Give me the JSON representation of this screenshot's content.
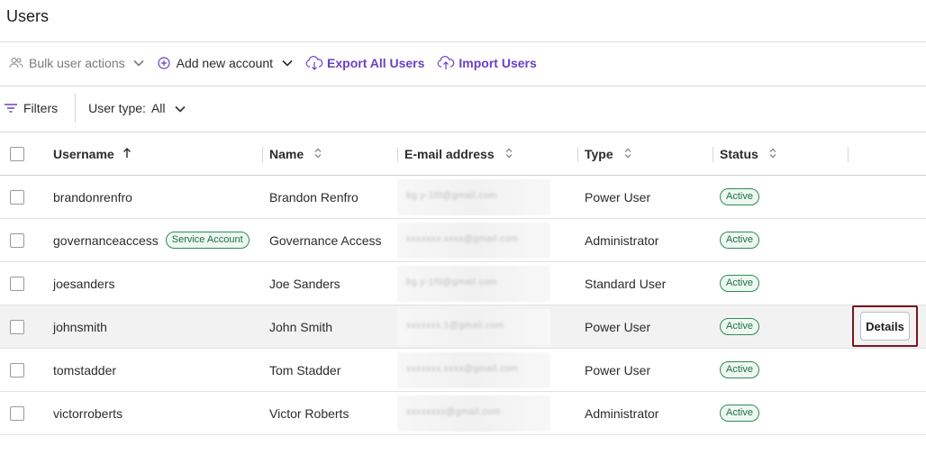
{
  "page": {
    "title": "Users"
  },
  "toolbar": {
    "bulk_label": "Bulk user actions",
    "add_label": "Add new account",
    "export_label": "Export All Users",
    "import_label": "Import Users"
  },
  "filters": {
    "filters_label": "Filters",
    "user_type_label": "User type:",
    "user_type_value": "All"
  },
  "table": {
    "headers": {
      "username": "Username",
      "name": "Name",
      "email": "E-mail address",
      "type": "Type",
      "status": "Status"
    },
    "rows": [
      {
        "username": "brandonrenfro",
        "name": "Brandon Renfro",
        "email_obscured": "bg.y-1f0@gmail.com",
        "type": "Power User",
        "status": "Active"
      },
      {
        "username": "governanceaccess",
        "badge": "Service Account",
        "name": "Governance Access",
        "email_obscured": "xxxxxxx.xxxx@gmail.com",
        "type": "Administrator",
        "status": "Active"
      },
      {
        "username": "joesanders",
        "name": "Joe Sanders",
        "email_obscured": "bg.y-1f0@gmail.com",
        "type": "Standard User",
        "status": "Active"
      },
      {
        "username": "johnsmith",
        "name": "John Smith",
        "email_obscured": "xxxxxxx.1@gmail.com",
        "type": "Power User",
        "status": "Active"
      },
      {
        "username": "tomstadder",
        "name": "Tom Stadder",
        "email_obscured": "xxxxxxx.xxxx@gmail.com",
        "type": "Power User",
        "status": "Active"
      },
      {
        "username": "victorroberts",
        "name": "Victor Roberts",
        "email_obscured": "xxxxxxxx@gmail.com",
        "type": "Administrator",
        "status": "Active"
      }
    ],
    "details_label": "Details"
  },
  "colors": {
    "accent": "#6a3fc7",
    "status_green": "#2e8b57",
    "highlight_box": "#7a1420",
    "row_highlight": "#f2f2f2"
  },
  "icons": [
    "users-icon",
    "chevron-down-icon",
    "plus-circle-icon",
    "cloud-download-icon",
    "cloud-upload-icon",
    "filter-icon",
    "sort-asc-icon",
    "sort-both-icon"
  ]
}
